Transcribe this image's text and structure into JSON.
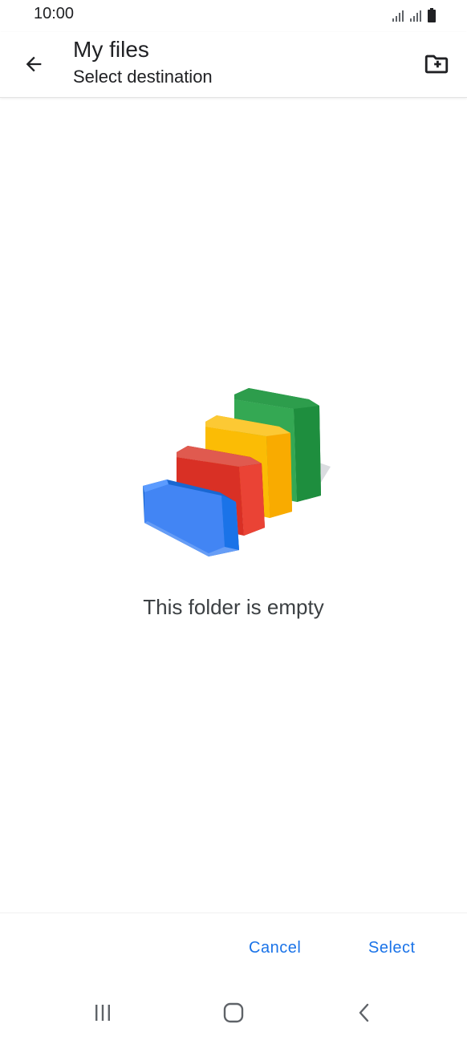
{
  "status_bar": {
    "time": "10:00",
    "icons": [
      "signal-icon",
      "signal-icon",
      "battery-icon"
    ]
  },
  "app_bar": {
    "back_icon": "arrow-back-icon",
    "title": "My files",
    "subtitle": "Select destination",
    "new_folder_icon": "create-new-folder-icon"
  },
  "content": {
    "illustration": "empty-folders-illustration",
    "empty_message": "This folder is empty"
  },
  "actions": {
    "cancel_label": "Cancel",
    "select_label": "Select"
  },
  "nav_bar": {
    "icons": [
      "recent-apps-icon",
      "home-icon",
      "back-icon"
    ]
  },
  "colors": {
    "accent": "#1a73e8",
    "folder_blue": "#4285f4",
    "folder_red": "#ea4335",
    "folder_yellow": "#fbbc05",
    "folder_green": "#34a853"
  }
}
